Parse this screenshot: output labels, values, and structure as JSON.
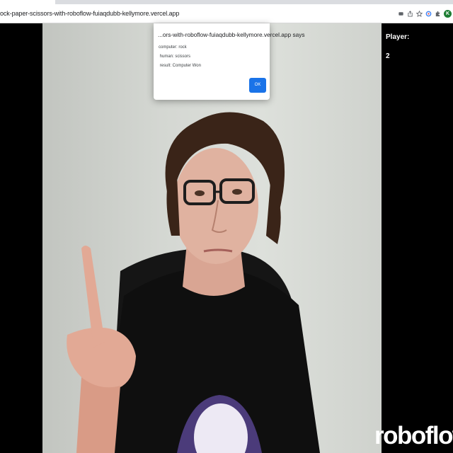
{
  "browser": {
    "url": "ock-paper-scissors-with-roboflow-fuiaqdubb-kellymore.vercel.app",
    "toolbar_icons": [
      "extension-puzzle-icon",
      "share-icon",
      "bookmark-star-icon",
      "google-lens-icon",
      "extensions-icon"
    ],
    "profile_initial": "K",
    "profile_color": "#1e7e34"
  },
  "alert": {
    "title": "...ors-with-roboflow-fuiaqdubb-kellymore.vercel.app says",
    "lines": [
      "computer: rock",
      " human: scissors",
      " result: Computer Won"
    ],
    "ok_label": "OK",
    "ok_color": "#1a73e8"
  },
  "scoreboard": {
    "player_label": "Player:",
    "player_value": "2"
  },
  "brand": {
    "logo_text": "roboflow"
  }
}
